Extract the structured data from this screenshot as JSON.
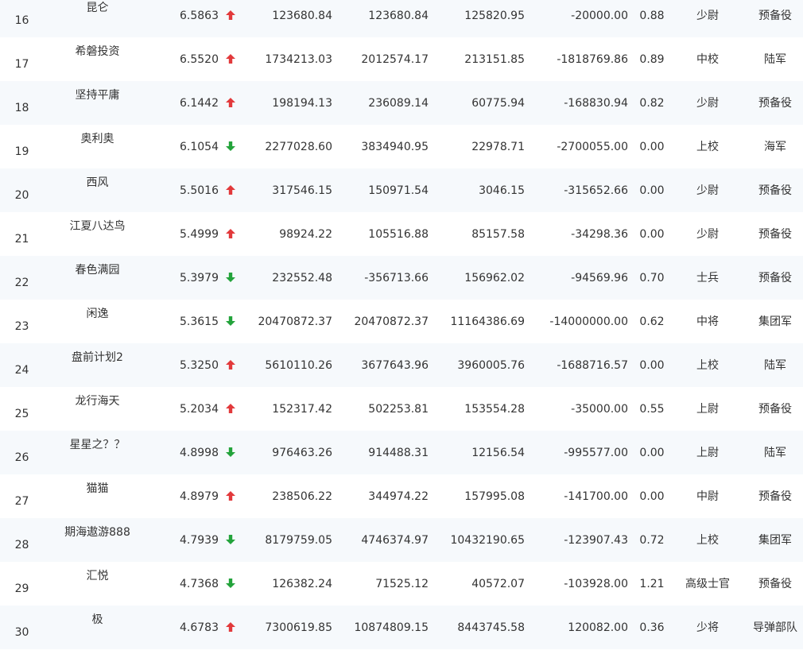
{
  "rows": [
    {
      "rank": "16",
      "name": "昆仑",
      "score": "6.5863",
      "trend": "up",
      "a": "123680.84",
      "b": "123680.84",
      "c": "125820.95",
      "d": "-20000.00",
      "e": "0.88",
      "rank_title": "少尉",
      "branch": "预备役"
    },
    {
      "rank": "17",
      "name": "希磐投资",
      "score": "6.5520",
      "trend": "up",
      "a": "1734213.03",
      "b": "2012574.17",
      "c": "213151.85",
      "d": "-1818769.86",
      "e": "0.89",
      "rank_title": "中校",
      "branch": "陆军"
    },
    {
      "rank": "18",
      "name": "坚持平庸",
      "score": "6.1442",
      "trend": "up",
      "a": "198194.13",
      "b": "236089.14",
      "c": "60775.94",
      "d": "-168830.94",
      "e": "0.82",
      "rank_title": "少尉",
      "branch": "预备役"
    },
    {
      "rank": "19",
      "name": "奥利奥",
      "score": "6.1054",
      "trend": "down",
      "a": "2277028.60",
      "b": "3834940.95",
      "c": "22978.71",
      "d": "-2700055.00",
      "e": "0.00",
      "rank_title": "上校",
      "branch": "海军"
    },
    {
      "rank": "20",
      "name": "西风",
      "score": "5.5016",
      "trend": "up",
      "a": "317546.15",
      "b": "150971.54",
      "c": "3046.15",
      "d": "-315652.66",
      "e": "0.00",
      "rank_title": "少尉",
      "branch": "预备役"
    },
    {
      "rank": "21",
      "name": "江夏八达鸟",
      "score": "5.4999",
      "trend": "up",
      "a": "98924.22",
      "b": "105516.88",
      "c": "85157.58",
      "d": "-34298.36",
      "e": "0.00",
      "rank_title": "少尉",
      "branch": "预备役"
    },
    {
      "rank": "22",
      "name": "春色满园",
      "score": "5.3979",
      "trend": "down",
      "a": "232552.48",
      "b": "-356713.66",
      "c": "156962.02",
      "d": "-94569.96",
      "e": "0.70",
      "rank_title": "士兵",
      "branch": "预备役"
    },
    {
      "rank": "23",
      "name": "闲逸",
      "score": "5.3615",
      "trend": "down",
      "a": "20470872.37",
      "b": "20470872.37",
      "c": "11164386.69",
      "d": "-14000000.00",
      "e": "0.62",
      "rank_title": "中将",
      "branch": "集团军"
    },
    {
      "rank": "24",
      "name": "盘前计划2",
      "score": "5.3250",
      "trend": "up",
      "a": "5610110.26",
      "b": "3677643.96",
      "c": "3960005.76",
      "d": "-1688716.57",
      "e": "0.00",
      "rank_title": "上校",
      "branch": "陆军"
    },
    {
      "rank": "25",
      "name": "龙行海天",
      "score": "5.2034",
      "trend": "up",
      "a": "152317.42",
      "b": "502253.81",
      "c": "153554.28",
      "d": "-35000.00",
      "e": "0.55",
      "rank_title": "上尉",
      "branch": "预备役"
    },
    {
      "rank": "26",
      "name": "星星之？？",
      "score": "4.8998",
      "trend": "down",
      "a": "976463.26",
      "b": "914488.31",
      "c": "12156.54",
      "d": "-995577.00",
      "e": "0.00",
      "rank_title": "上尉",
      "branch": "陆军"
    },
    {
      "rank": "27",
      "name": "猫猫",
      "score": "4.8979",
      "trend": "up",
      "a": "238506.22",
      "b": "344974.22",
      "c": "157995.08",
      "d": "-141700.00",
      "e": "0.00",
      "rank_title": "中尉",
      "branch": "预备役"
    },
    {
      "rank": "28",
      "name": "期海遨游888",
      "score": "4.7939",
      "trend": "down",
      "a": "8179759.05",
      "b": "4746374.97",
      "c": "10432190.65",
      "d": "-123907.43",
      "e": "0.72",
      "rank_title": "上校",
      "branch": "集团军"
    },
    {
      "rank": "29",
      "name": "汇悦",
      "score": "4.7368",
      "trend": "down",
      "a": "126382.24",
      "b": "71525.12",
      "c": "40572.07",
      "d": "-103928.00",
      "e": "1.21",
      "rank_title": "高级士官",
      "branch": "预备役"
    },
    {
      "rank": "30",
      "name": "极",
      "score": "4.6783",
      "trend": "up",
      "a": "7300619.85",
      "b": "10874809.15",
      "c": "8443745.58",
      "d": "120082.00",
      "e": "0.36",
      "rank_title": "少将",
      "branch": "导弹部队"
    }
  ],
  "colors": {
    "up": "#e2393b",
    "down": "#23a33b",
    "stripe": "#f6f9fc",
    "text": "#333333"
  },
  "icons": {
    "up": "arrow-up-icon",
    "down": "arrow-down-icon"
  }
}
